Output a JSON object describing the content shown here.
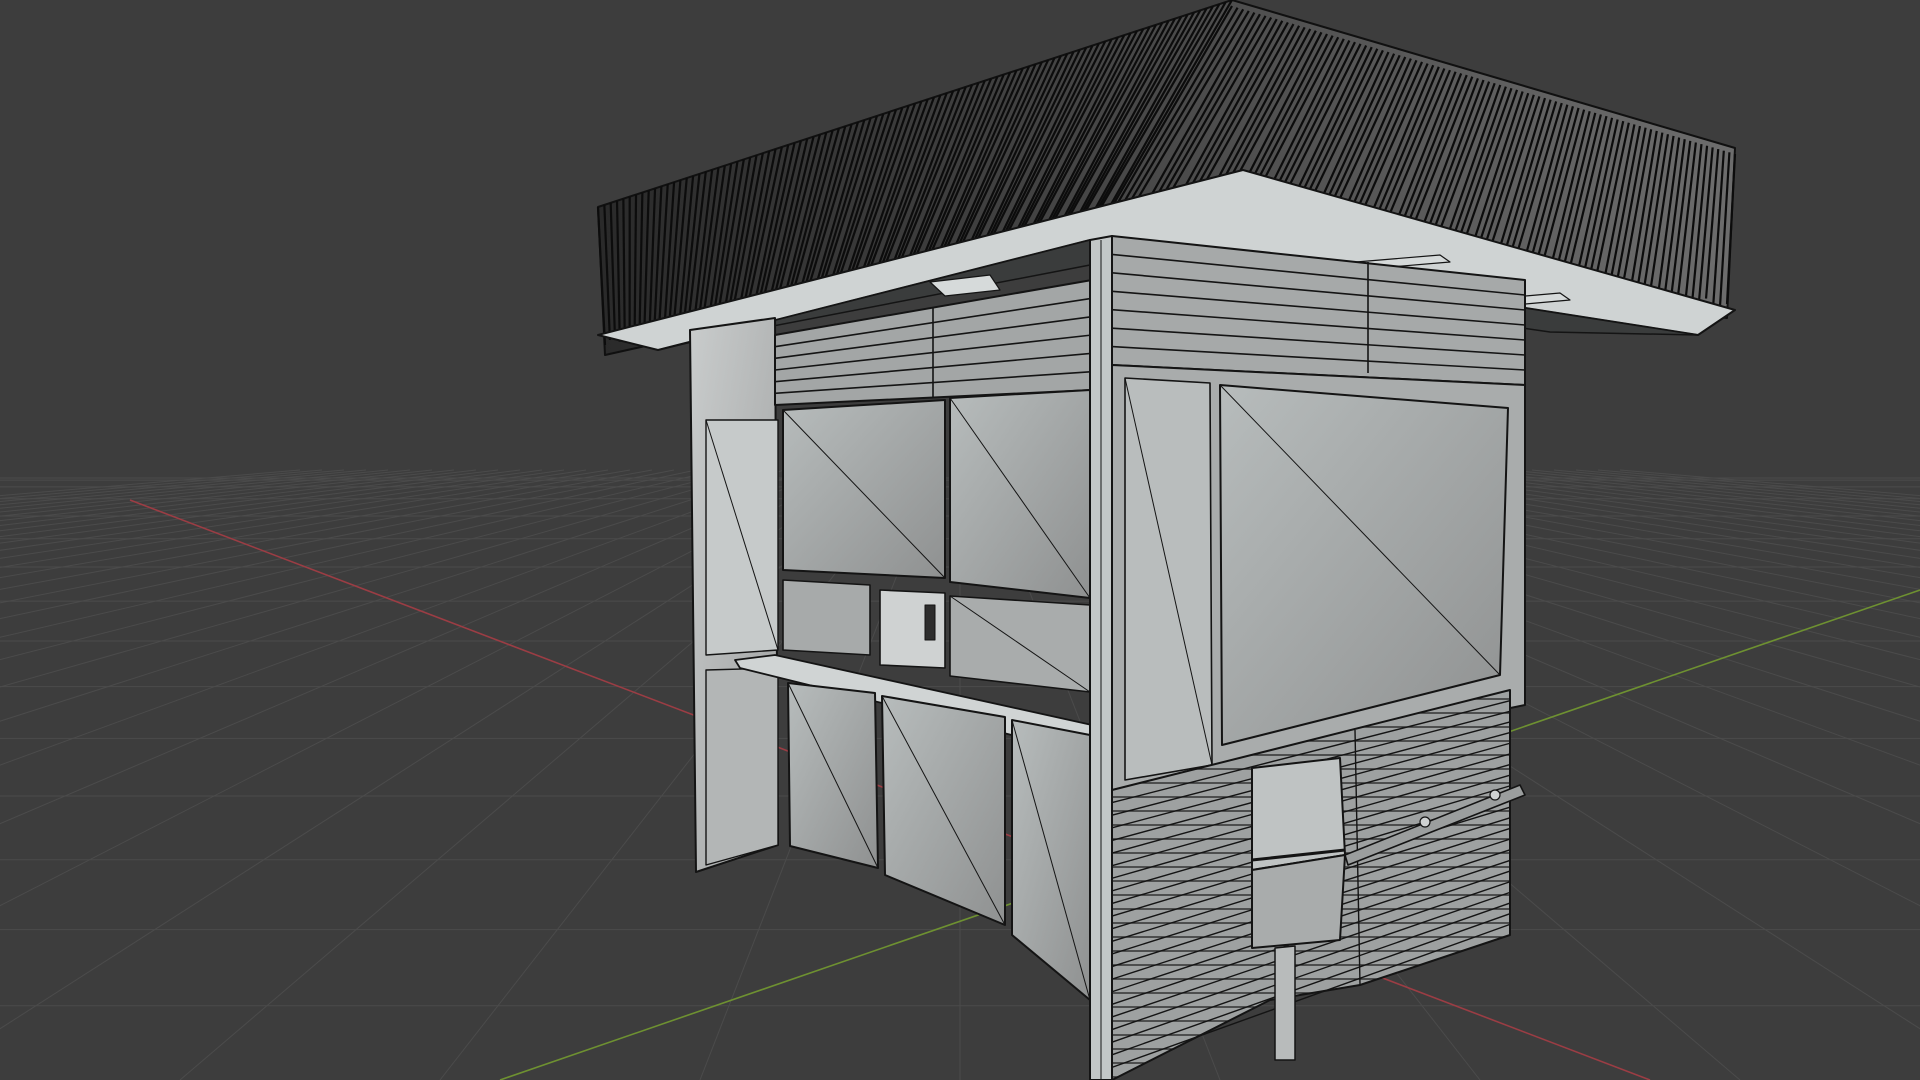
{
  "viewport": {
    "background_color": "#3d3d3d",
    "grid_color": "#4b4b4b",
    "x_axis_color": "#9b3d44",
    "y_axis_color": "#6e9131",
    "wire_color": "#141414",
    "surface_color": "#a8a8a8",
    "surface_light_color": "#c4c8c8",
    "roof_color": "#1d1d1d"
  },
  "scene": {
    "object_name": "kiosk-model",
    "display_mode": "solid-with-wireframe"
  }
}
